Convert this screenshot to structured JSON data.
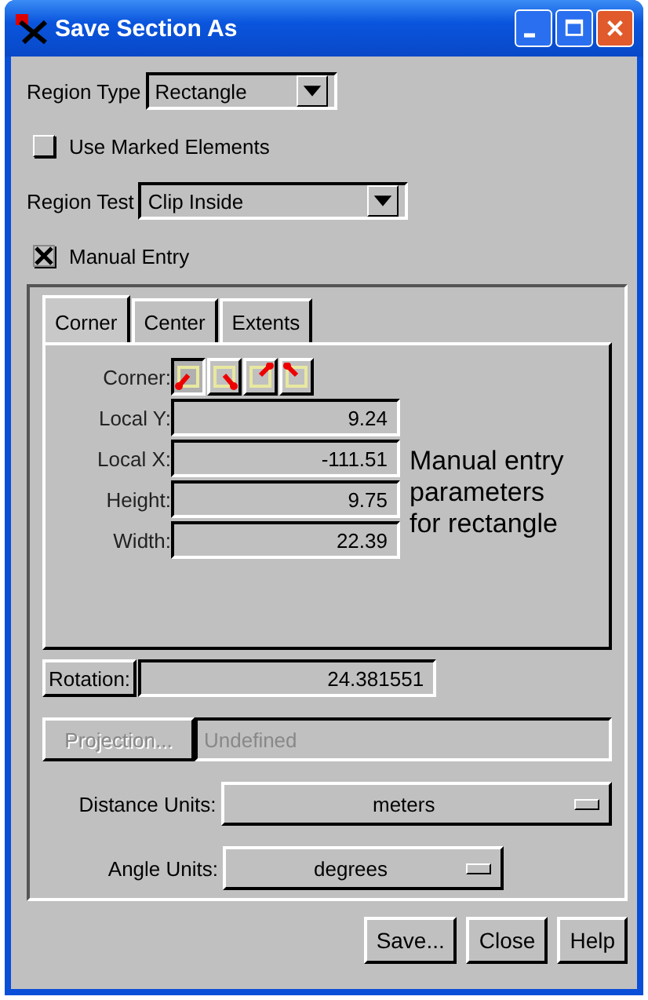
{
  "window": {
    "title": "Save Section As"
  },
  "region_type": {
    "label": "Region Type",
    "value": "Rectangle"
  },
  "use_marked_elements": {
    "label": "Use Marked Elements",
    "checked": false
  },
  "region_test": {
    "label": "Region Test",
    "value": "Clip Inside"
  },
  "manual_entry": {
    "label": "Manual Entry",
    "checked": true
  },
  "tabs": [
    {
      "label": "Corner",
      "selected": true
    },
    {
      "label": "Center",
      "selected": false
    },
    {
      "label": "Extents",
      "selected": false
    }
  ],
  "corner": {
    "label": "Corner:",
    "buttons": [
      {
        "selected": true
      },
      {
        "selected": false
      },
      {
        "selected": false
      },
      {
        "selected": false
      }
    ]
  },
  "fields": [
    {
      "label": "Local Y:",
      "value": "9.24"
    },
    {
      "label": "Local X:",
      "value": "-111.51"
    },
    {
      "label": "Height:",
      "value": "9.75"
    },
    {
      "label": "Width:",
      "value": "22.39"
    }
  ],
  "note": "Manual entry parameters for rectangle",
  "rotation": {
    "label": "Rotation:",
    "value": "24.381551"
  },
  "projection": {
    "label": "Projection...",
    "value": "Undefined",
    "disabled": true
  },
  "distance_units": {
    "label": "Distance Units:",
    "value": "meters"
  },
  "angle_units": {
    "label": "Angle Units:",
    "value": "degrees"
  },
  "buttons": [
    "Save...",
    "Close",
    "Help"
  ]
}
